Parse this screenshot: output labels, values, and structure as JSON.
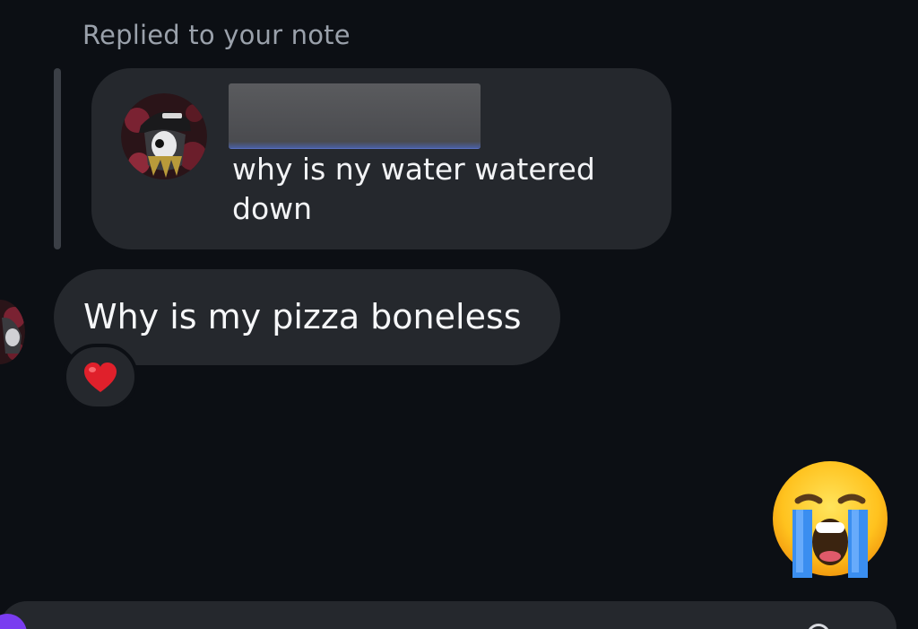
{
  "thread": {
    "replied_label": "Replied to your note",
    "note": {
      "text": "why is ny water watered down"
    },
    "message": {
      "text": "Why is my pizza boneless",
      "reaction": "heart"
    },
    "sent": {
      "emoji": "loudly-crying-face"
    }
  },
  "colors": {
    "background": "#0c0f14",
    "bubble": "#25282d",
    "secondary_text": "#9aa1ab",
    "accent": "#7a3cf0"
  }
}
